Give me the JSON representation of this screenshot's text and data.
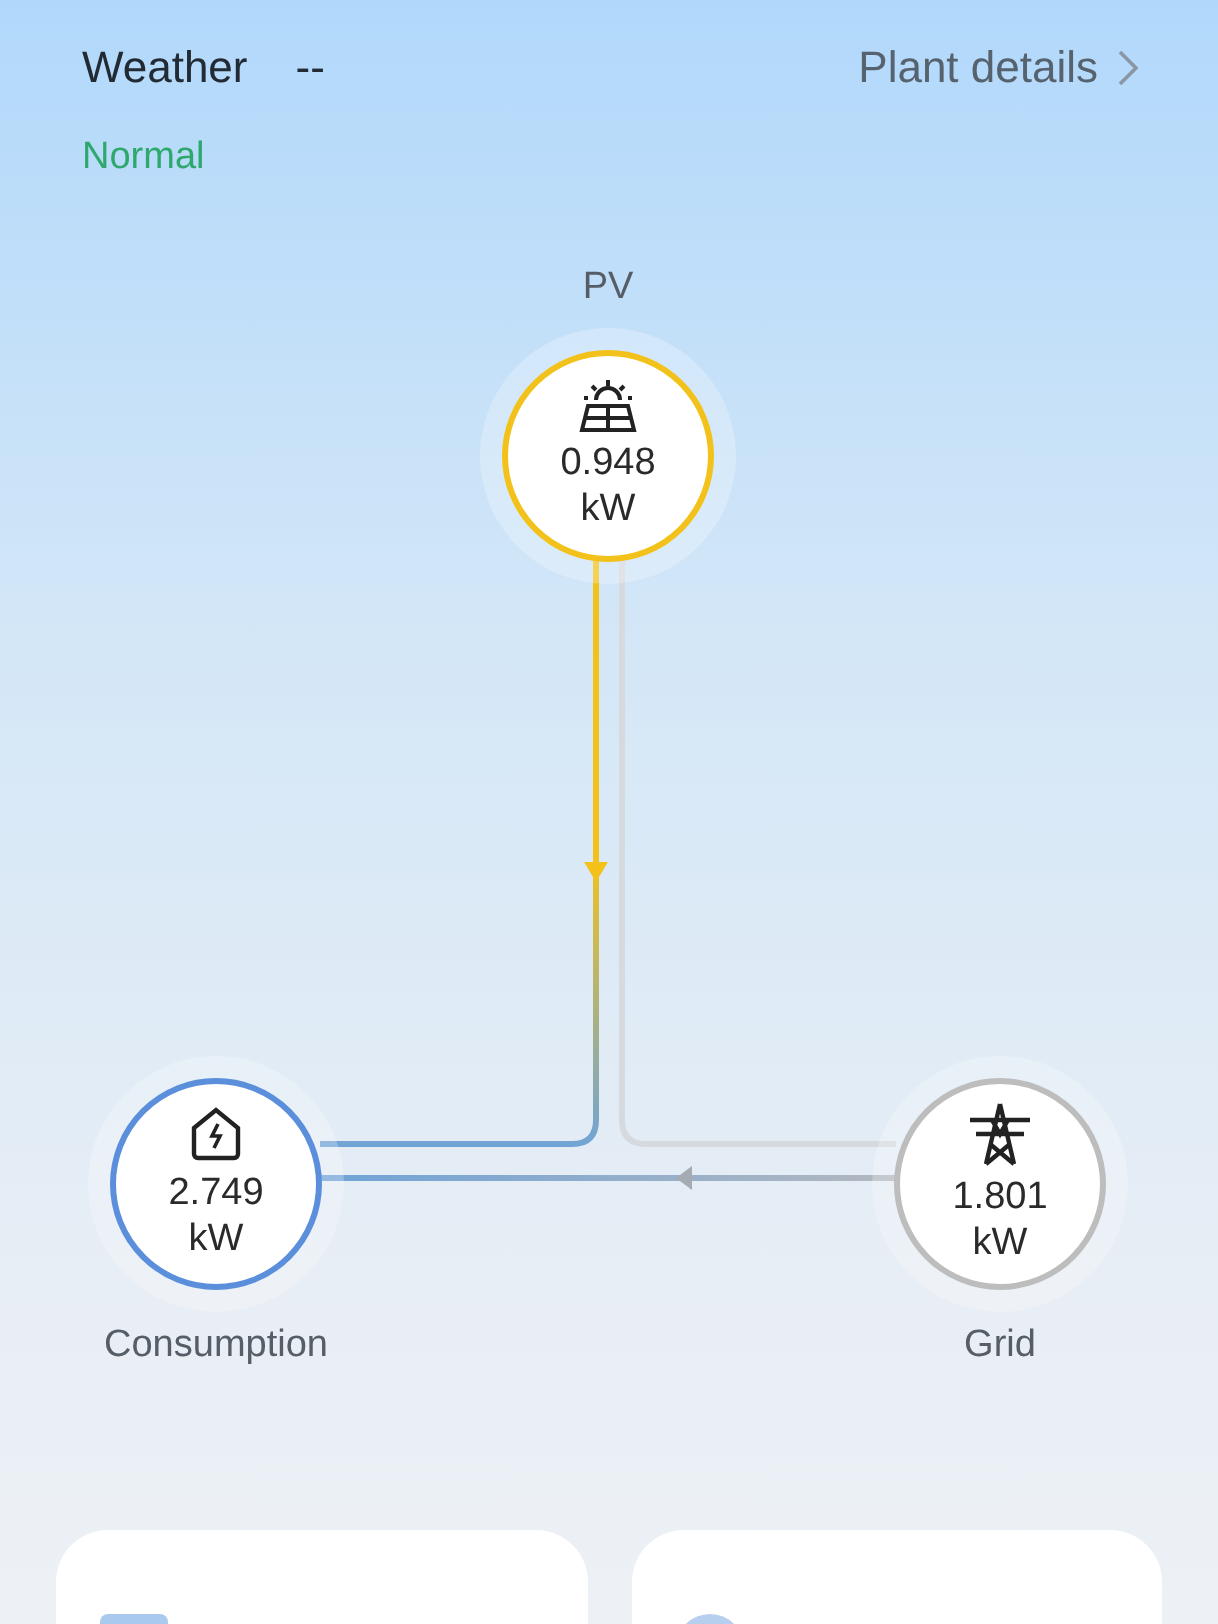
{
  "header": {
    "weather_label": "Weather",
    "weather_value": "--",
    "details_link": "Plant details",
    "status": "Normal"
  },
  "nodes": [
    {
      "kind": "pv",
      "label": "PV",
      "value": "0.948",
      "unit": "kW"
    },
    {
      "kind": "home",
      "label": "Consumption",
      "value": "2.749",
      "unit": "kW"
    },
    {
      "kind": "grid",
      "label": "Grid",
      "value": "1.801",
      "unit": "kW"
    }
  ],
  "cards": [
    {
      "kind": "energy"
    },
    {
      "kind": "money"
    }
  ]
}
